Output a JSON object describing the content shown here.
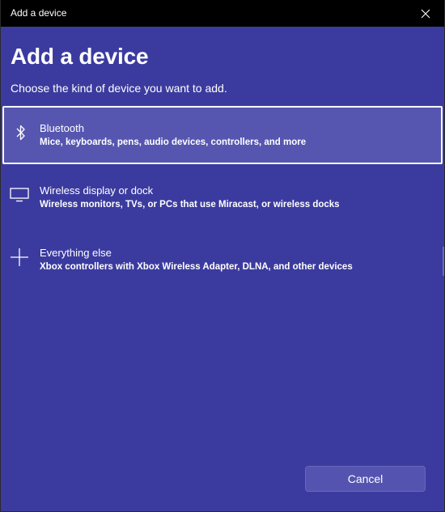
{
  "window": {
    "title": "Add a device"
  },
  "page": {
    "heading": "Add a device",
    "subheading": "Choose the kind of device you want to add."
  },
  "options": [
    {
      "icon": "bluetooth-icon",
      "title": "Bluetooth",
      "description": "Mice, keyboards, pens, audio devices, controllers, and more",
      "selected": true
    },
    {
      "icon": "monitor-icon",
      "title": "Wireless display or dock",
      "description": "Wireless monitors, TVs, or PCs that use Miracast, or wireless docks",
      "selected": false
    },
    {
      "icon": "plus-icon",
      "title": "Everything else",
      "description": "Xbox controllers with Xbox Wireless Adapter, DLNA, and other devices",
      "selected": false
    }
  ],
  "footer": {
    "cancel_label": "Cancel"
  },
  "colors": {
    "background": "#3b3b9f",
    "titlebar": "#000000",
    "selected_option": "#5656b1",
    "button": "#5454b0",
    "text": "#ffffff"
  }
}
